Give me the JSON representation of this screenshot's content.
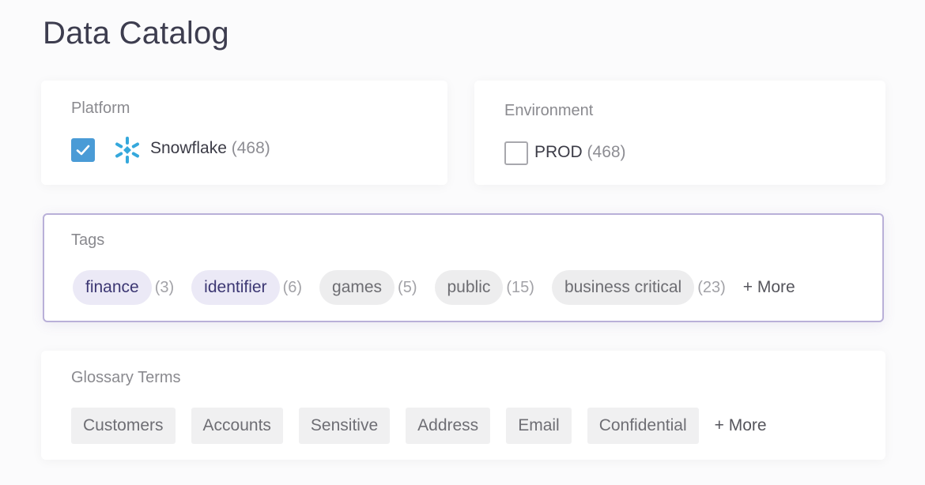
{
  "page": {
    "title": "Data Catalog"
  },
  "platform": {
    "label": "Platform",
    "option": {
      "name": "Snowflake",
      "count": "(468)",
      "checked": true,
      "icon": "snowflake-icon"
    }
  },
  "environment": {
    "label": "Environment",
    "option": {
      "name": "PROD",
      "count": "(468)",
      "checked": false
    }
  },
  "tags": {
    "label": "Tags",
    "items": [
      {
        "name": "finance",
        "count": "(3)",
        "selected": true
      },
      {
        "name": "identifier",
        "count": "(6)",
        "selected": true
      },
      {
        "name": "games",
        "count": "(5)",
        "selected": false
      },
      {
        "name": "public",
        "count": "(15)",
        "selected": false
      },
      {
        "name": "business critical",
        "count": "(23)",
        "selected": false
      }
    ],
    "more_label": "+ More"
  },
  "glossary": {
    "label": "Glossary Terms",
    "items": [
      "Customers",
      "Accounts",
      "Sensitive",
      "Address",
      "Email",
      "Confidential"
    ],
    "more_label": "+ More"
  },
  "colors": {
    "accent_blue": "#4a9bd6",
    "snowflake_icon": "#35a8dc",
    "tags_border": "#b9b0d8",
    "selected_tag_bg": "#ebe9f6",
    "selected_tag_text": "#3c3773"
  }
}
